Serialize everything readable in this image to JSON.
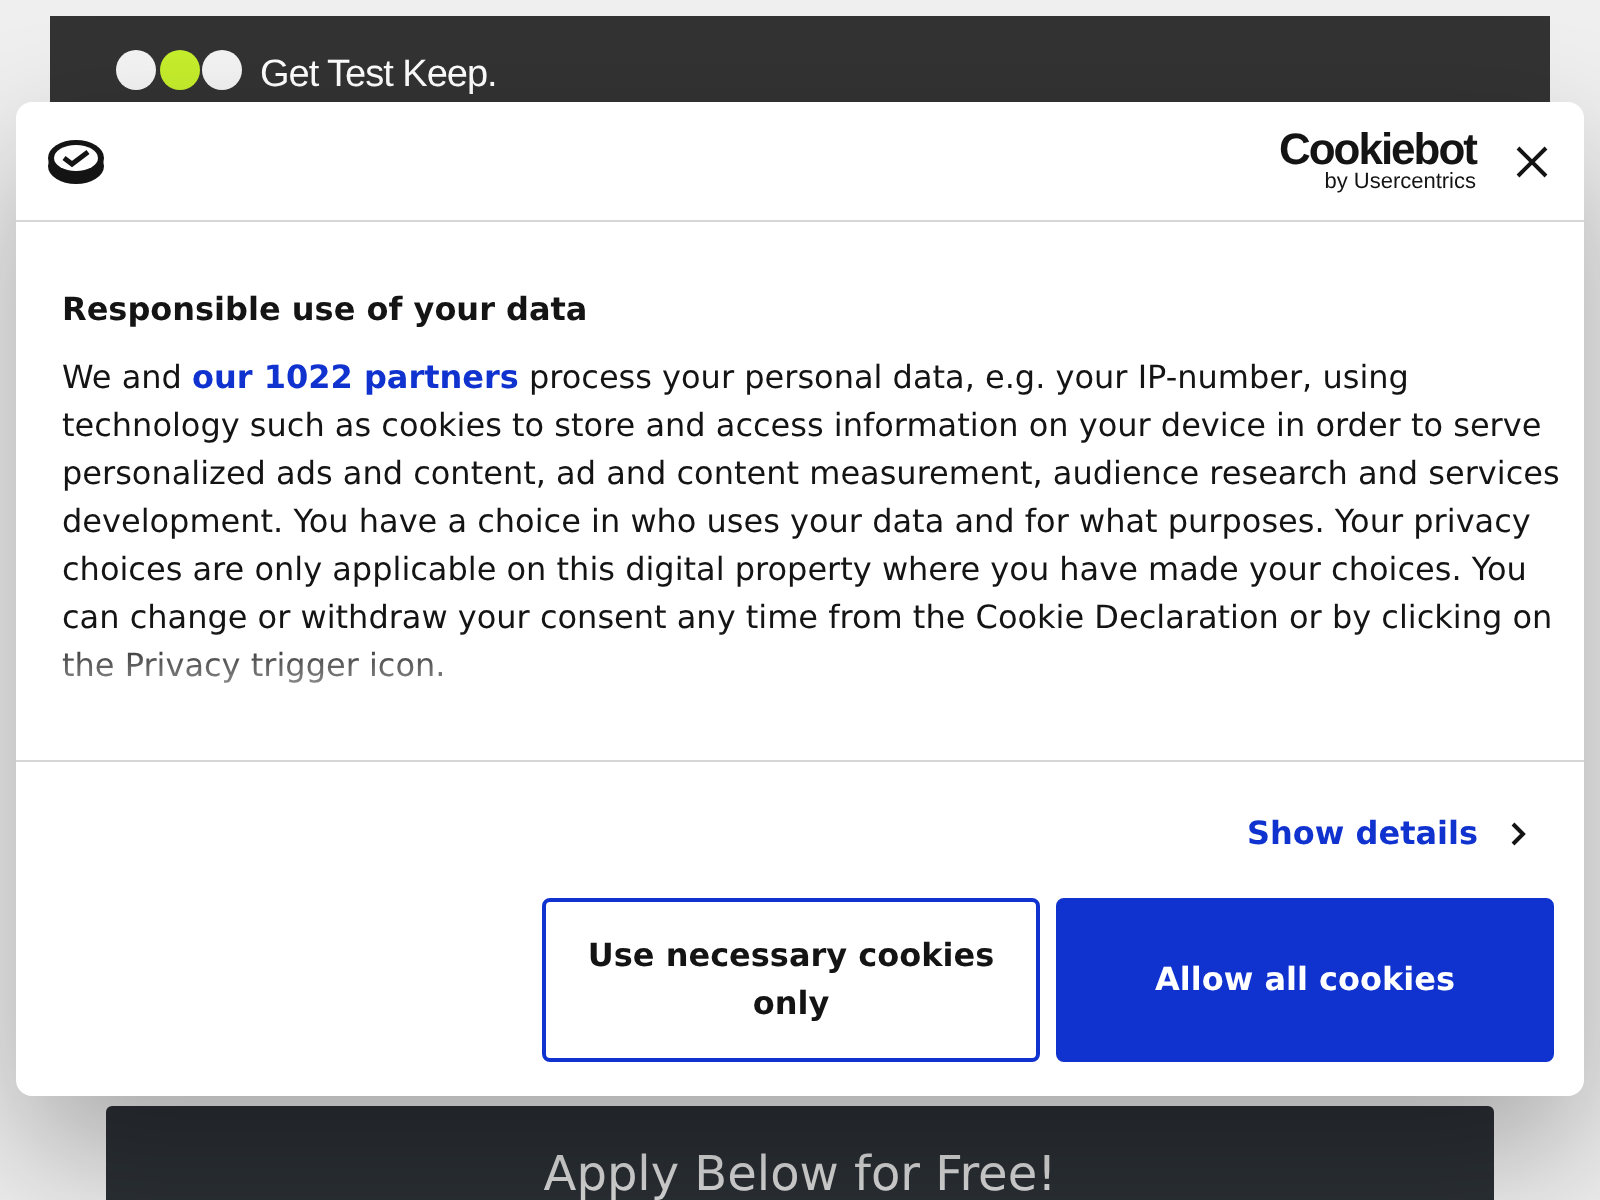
{
  "site_header": {
    "logo_text": "Get Test Keep."
  },
  "consent_dialog": {
    "brand": "Cookiebot",
    "brand_sub": "by Usercentrics",
    "heading": "Responsible use of your data",
    "body_start": "We and",
    "body_link": "our 1022 partners",
    "body_end": "process your personal data, e.g. your IP-number, using technology such as cookies to store and access information on your device in order to serve personalized ads and content, ad and content measurement, audience research and services development. You have a choice in who uses your data and for what purposes. Your privacy choices are only applicable on this digital property where you have made your choices. You can change or withdraw your consent any time from the Cookie Declaration or by clicking on the Privacy trigger icon.",
    "show_details": "Show details",
    "buttons": [
      {
        "label": "Use necessary cookies only",
        "kind": "outline"
      },
      {
        "label": "Allow all cookies",
        "kind": "primary"
      }
    ]
  },
  "banner": {
    "text": "Apply Below for Free!"
  }
}
